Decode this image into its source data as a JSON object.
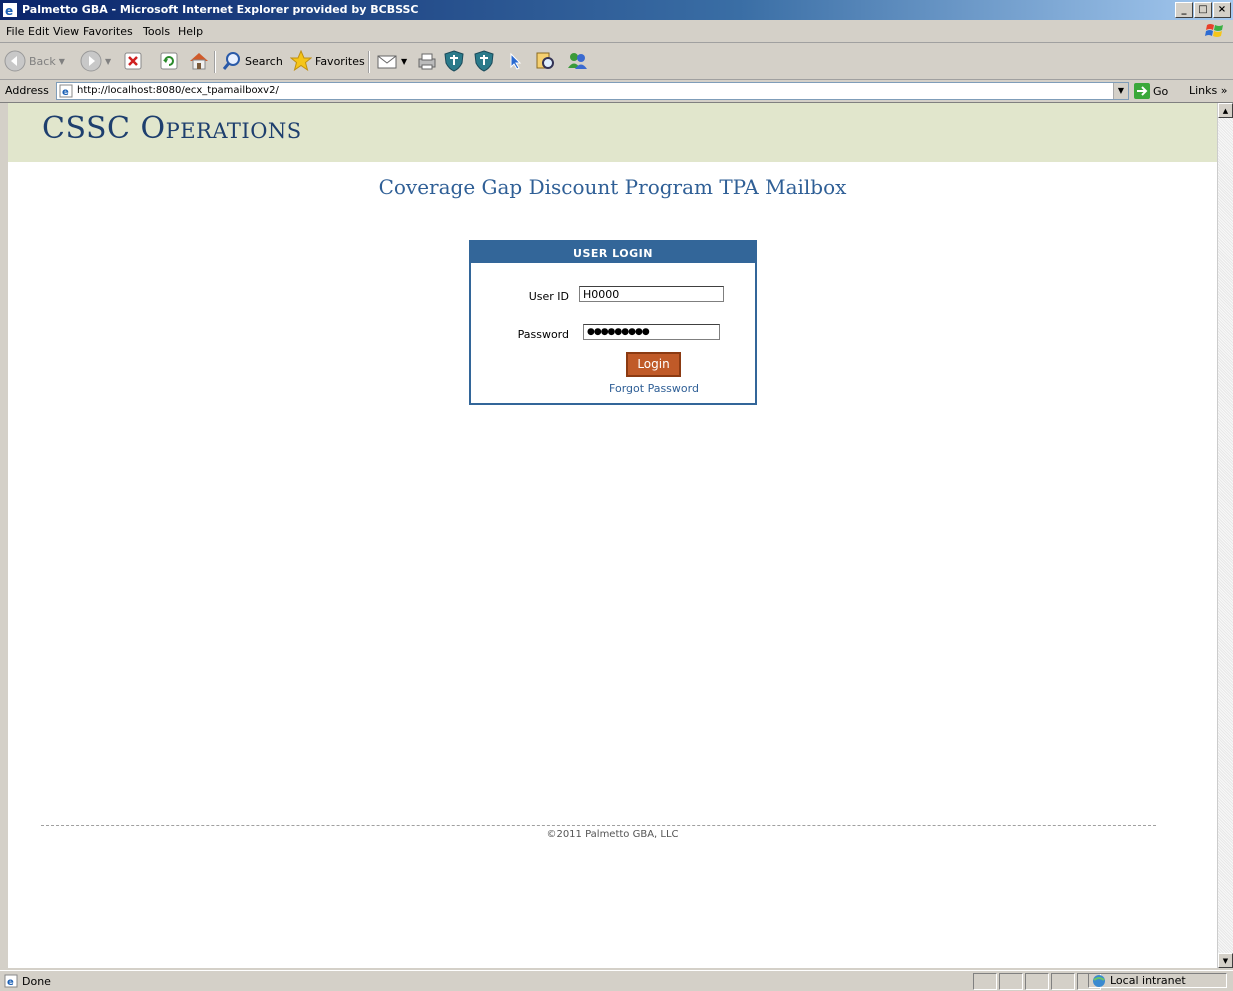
{
  "window": {
    "title": "Palmetto GBA - Microsoft Internet Explorer provided by BCBSSC",
    "buttons": [
      "_",
      "□",
      "×"
    ]
  },
  "menu": [
    "File",
    "Edit",
    "View",
    "Favorites",
    "Tools",
    "Help"
  ],
  "toolbar": {
    "back_label": "Back",
    "search_label": "Search",
    "favorites_label": "Favorites"
  },
  "address": {
    "label": "Address",
    "url": "http://localhost:8080/ecx_tpamailboxv2/",
    "go_label": "Go",
    "links_label": "Links"
  },
  "page": {
    "banner_title": "CSSC Operations",
    "heading": "Coverage Gap Discount Program TPA Mailbox",
    "login": {
      "header": "USER LOGIN",
      "user_id_label": "User ID",
      "user_id_value": "H0000",
      "password_label": "Password",
      "password_value": "●●●●●●●●●",
      "login_button": "Login",
      "forgot_link": "Forgot Password"
    },
    "footer": "©2011 Palmetto GBA, LLC"
  },
  "status": {
    "left_text": "Done",
    "zone_text": "Local intranet"
  },
  "colors": {
    "banner_bg": "#e1e6cc",
    "brand_blue": "#336699",
    "login_button": "#c05a28"
  }
}
